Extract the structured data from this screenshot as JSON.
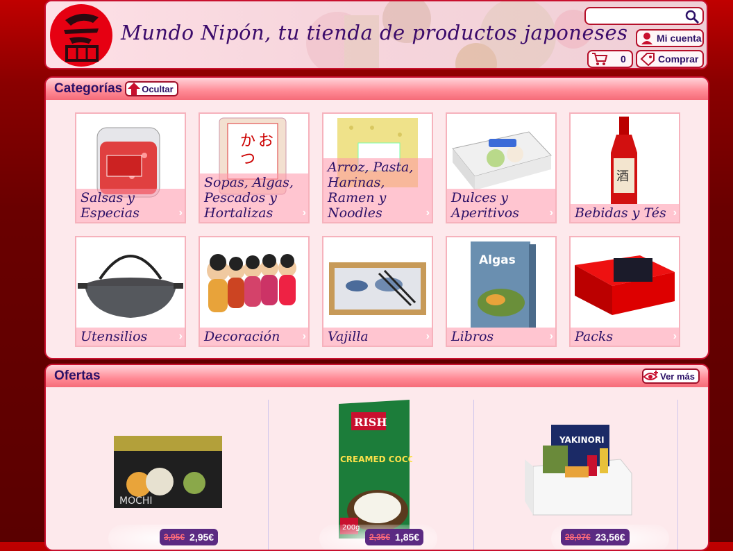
{
  "header": {
    "site_title": "Mundo Nipón, tu tienda de productos japoneses",
    "search": {
      "value": "",
      "placeholder": ""
    },
    "account_label": "Mi cuenta",
    "cart_count": "0",
    "buy_label": "Comprar"
  },
  "categories": {
    "title": "Categorías",
    "hide_label": "Ocultar",
    "items": [
      {
        "label": "Salsas y Especias"
      },
      {
        "label": "Sopas, Algas, Pescados y Hortalizas"
      },
      {
        "label": "Arroz, Pasta, Harinas, Ramen y Noodles"
      },
      {
        "label": "Dulces y Aperitivos"
      },
      {
        "label": "Bebidas y Tés"
      },
      {
        "label": "Utensilios"
      },
      {
        "label": "Decoración"
      },
      {
        "label": "Vajilla"
      },
      {
        "label": "Libros"
      },
      {
        "label": "Packs"
      }
    ]
  },
  "offers": {
    "title": "Ofertas",
    "see_more_label": "Ver más",
    "items": [
      {
        "old_price": "3,95€",
        "price": "2,95€",
        "box_text": "MOCHI"
      },
      {
        "old_price": "2,35€",
        "price": "1,85€",
        "box_brand": "RISH",
        "box_text": "CREAMED COCONUT",
        "box_weight": "200g"
      },
      {
        "old_price": "28,07€",
        "price": "23,56€",
        "box_text": "YAKINORI"
      }
    ]
  },
  "colors": {
    "accent": "#c8102e",
    "text": "#2b1066",
    "price_bg": "#5b2a82"
  }
}
